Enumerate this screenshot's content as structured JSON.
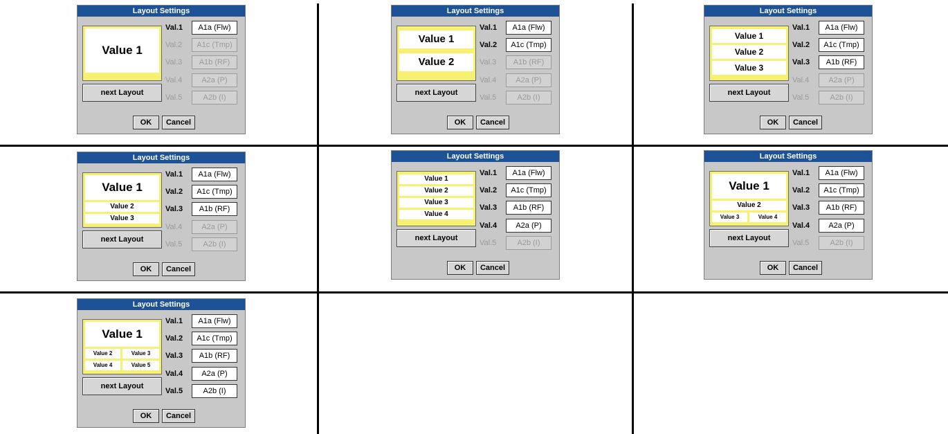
{
  "dialog": {
    "title": "Layout Settings",
    "next_layout_label": "next Layout",
    "ok_label": "OK",
    "cancel_label": "Cancel"
  },
  "val_labels": [
    "Val.1",
    "Val.2",
    "Val.3",
    "Val.4",
    "Val.5"
  ],
  "channels": [
    "A1a (Flw)",
    "A1c (Tmp)",
    "A1b (RF)",
    "A2a (P)",
    "A2b (I)"
  ],
  "dialogs": [
    {
      "layout": 1,
      "active_values": 1,
      "preview": [
        "Value 1"
      ]
    },
    {
      "layout": 2,
      "active_values": 2,
      "preview": [
        "Value 1",
        "Value 2"
      ]
    },
    {
      "layout": 3,
      "active_values": 3,
      "preview": [
        "Value 1",
        "Value 2",
        "Value 3"
      ]
    },
    {
      "layout": 4,
      "active_values": 3,
      "preview": [
        "Value 1",
        "Value 2",
        "Value 3"
      ]
    },
    {
      "layout": 5,
      "active_values": 4,
      "preview": [
        "Value 1",
        "Value 2",
        "Value 3",
        "Value 4"
      ]
    },
    {
      "layout": 6,
      "active_values": 4,
      "preview": [
        "Value 1",
        "Value 2",
        "Value 3",
        "Value 4"
      ]
    },
    {
      "layout": 7,
      "active_values": 5,
      "preview": [
        "Value 1",
        "Value 2",
        "Value 3",
        "Value 4",
        "Value 5"
      ]
    }
  ],
  "colors": {
    "titlebar": "#1e5296",
    "preview_bg": "#f7f171",
    "dialog_bg": "#c8c8c8",
    "disabled_text": "#9a9a9a"
  }
}
